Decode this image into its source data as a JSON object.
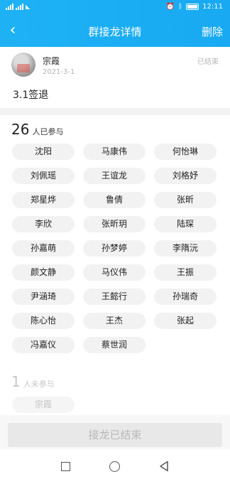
{
  "status_bar": {
    "time": "12:11"
  },
  "header": {
    "title": "群接龙详情",
    "delete_label": "删除",
    "back_icon": "chevron-left-icon"
  },
  "post": {
    "author": "宗霞",
    "date": "2021-3-1",
    "status": "已结束",
    "content": "3.1签退"
  },
  "joined": {
    "count": "26",
    "label": "人已参与",
    "members": [
      "沈阳",
      "马康伟",
      "何怡琳",
      "刘佩瑶",
      "王谊龙",
      "刘格妤",
      "郑星烨",
      "鲁倩",
      "张昕",
      "李欣",
      "张昕玥",
      "陆琛",
      "孙嘉萌",
      "孙梦婷",
      "李隋沅",
      "颜文静",
      "马仪伟",
      "王振",
      "尹涵琦",
      "王懿行",
      "孙瑞奇",
      "陈心怡",
      "王杰",
      "张起",
      "冯嘉仪",
      "蔡世润"
    ]
  },
  "not_joined": {
    "count": "1",
    "label": "人未参与",
    "members": [
      "宗霞"
    ]
  },
  "footer": {
    "button_label": "接龙已结束"
  },
  "colors": {
    "header_blue": "#1eb2f5",
    "chip_bg": "#f2f2f2",
    "disabled_text": "#b9b9b9"
  }
}
